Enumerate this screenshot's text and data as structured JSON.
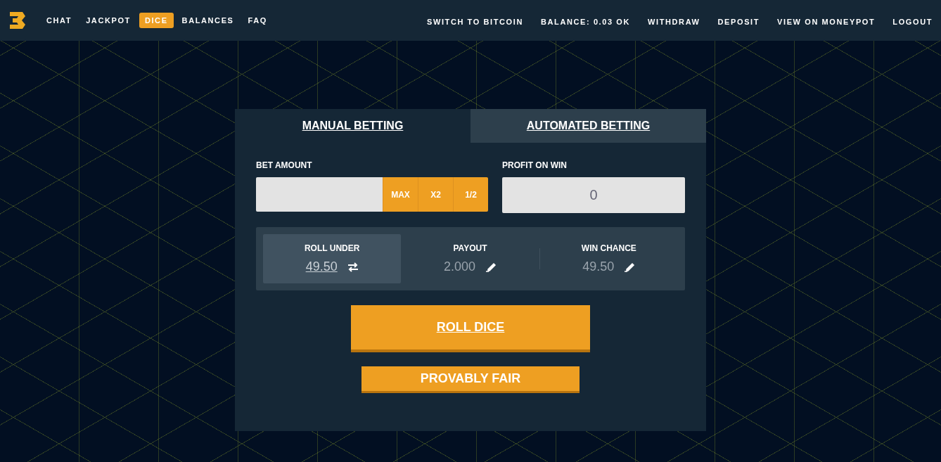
{
  "nav": {
    "left": [
      {
        "label": "CHAT",
        "selected": false
      },
      {
        "label": "JACKPOT",
        "selected": false
      },
      {
        "label": "DICE",
        "selected": true
      },
      {
        "label": "BALANCES",
        "selected": false
      },
      {
        "label": "FAQ",
        "selected": false
      }
    ],
    "right": [
      "SWITCH TO BITCOIN",
      "BALANCE: 0.03 OK",
      "WITHDRAW",
      "DEPOSIT",
      "VIEW ON MONEYPOT",
      "LOGOUT"
    ]
  },
  "tabs": [
    {
      "label": "MANUAL BETTING",
      "selected": true
    },
    {
      "label": "AUTOMATED BETTING",
      "selected": false
    }
  ],
  "bet_amount": {
    "label": "BET AMOUNT",
    "buttons": [
      "MAX",
      "X2",
      "1/2"
    ]
  },
  "profit_on_win": {
    "label": "PROFIT ON WIN",
    "value": "0"
  },
  "stats": [
    {
      "label": "ROLL UNDER",
      "value": "49.50",
      "kind": "swap",
      "selected": true
    },
    {
      "label": "PAYOUT",
      "value": "2.000",
      "kind": "edit",
      "selected": false
    },
    {
      "label": "WIN CHANCE",
      "value": "49.50",
      "kind": "edit",
      "selected": false
    }
  ],
  "roll_button": "ROLL DICE",
  "fair_button": "PROVABLY FAIR"
}
